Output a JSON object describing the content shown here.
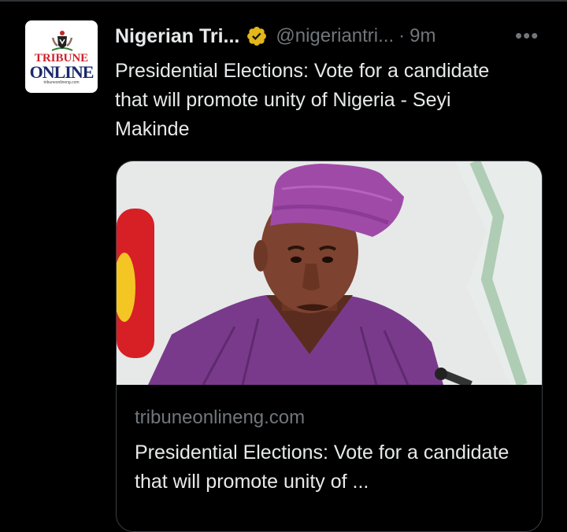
{
  "tweet": {
    "author_name": "Nigerian Tri...",
    "handle": "@nigeriantri...",
    "separator": "·",
    "time": "9m",
    "more_label": "•••",
    "text": "Presidential Elections: Vote for a candidate that will promote unity of Nigeria - Seyi Makinde"
  },
  "avatar": {
    "logo_top": "TRIBUNE",
    "logo_bottom": "ONLINE",
    "logo_url": "tribuneonlineng.com"
  },
  "card": {
    "domain": "tribuneonlineng.com",
    "title": "Presidential Elections: Vote for a candidate that will promote unity of ..."
  },
  "colors": {
    "background": "#000000",
    "text_primary": "#e7e9ea",
    "text_secondary": "#71767b",
    "verified_badge": "#e2b719",
    "card_border": "#3a3f44",
    "brand_red": "#d0202a",
    "brand_navy": "#1a2a6c"
  },
  "icons": {
    "verified": "verified-badge-icon",
    "more": "more-horizontal-icon"
  }
}
